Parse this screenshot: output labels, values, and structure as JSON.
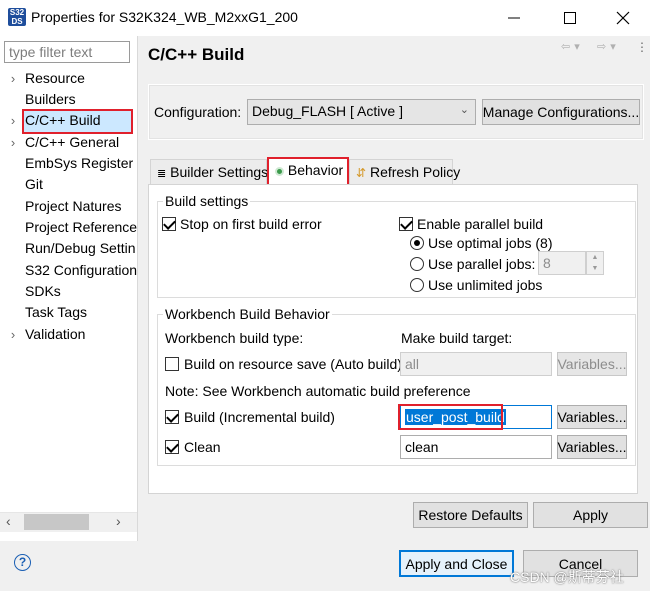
{
  "window": {
    "title": "Properties for S32K324_WB_M2xxG1_200",
    "app_icon_text": "S32 DS"
  },
  "sidebar": {
    "filter_placeholder": "type filter text",
    "items": [
      {
        "label": "Resource",
        "expandable": true
      },
      {
        "label": "Builders",
        "expandable": false
      },
      {
        "label": "C/C++ Build",
        "expandable": true,
        "selected": true
      },
      {
        "label": "C/C++ General",
        "expandable": true
      },
      {
        "label": "EmbSys Register V",
        "expandable": false
      },
      {
        "label": "Git",
        "expandable": false
      },
      {
        "label": "Project Natures",
        "expandable": false
      },
      {
        "label": "Project References",
        "expandable": false
      },
      {
        "label": "Run/Debug Settin",
        "expandable": false
      },
      {
        "label": "S32 Configuration",
        "expandable": false
      },
      {
        "label": "SDKs",
        "expandable": false
      },
      {
        "label": "Task Tags",
        "expandable": false
      },
      {
        "label": "Validation",
        "expandable": true
      }
    ]
  },
  "page": {
    "title": "C/C++ Build",
    "configuration_label": "Configuration:",
    "configuration_value": "Debug_FLASH  [ Active ]",
    "manage_button": "Manage Configurations...",
    "tabs": [
      {
        "label": "Builder Settings",
        "icon": "list-icon"
      },
      {
        "label": "Behavior",
        "icon": "radio-dot-icon",
        "active": true
      },
      {
        "label": "Refresh Policy",
        "icon": "refresh-icon"
      }
    ],
    "build_settings": {
      "title": "Build settings",
      "stop_on_error": "Stop on first build error",
      "stop_on_error_checked": true,
      "enable_parallel": "Enable parallel build",
      "enable_parallel_checked": true,
      "use_optimal": "Use optimal jobs (8)",
      "use_parallel": "Use parallel jobs:",
      "parallel_jobs_value": "8",
      "use_unlimited": "Use unlimited jobs"
    },
    "workbench": {
      "title": "Workbench Build Behavior",
      "build_type_label": "Workbench build type:",
      "make_target_label": "Make build target:",
      "auto_build_label": "Build on resource save (Auto build)",
      "auto_build_checked": false,
      "auto_build_target": "all",
      "note": "Note: See Workbench automatic build preference",
      "incremental_label": "Build (Incremental build)",
      "incremental_checked": true,
      "incremental_target": "user_post_build",
      "clean_label": "Clean",
      "clean_checked": true,
      "clean_target": "clean",
      "variables_label": "Variables..."
    },
    "restore_defaults": "Restore Defaults",
    "apply": "Apply"
  },
  "footer": {
    "apply_close": "Apply and Close",
    "cancel": "Cancel",
    "watermark": "CSDN @斯蒂芬社"
  }
}
